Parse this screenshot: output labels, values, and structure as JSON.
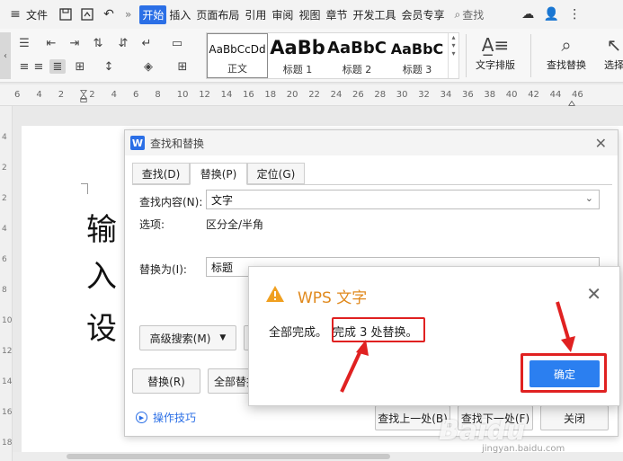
{
  "menubar": {
    "file": "文件",
    "more": "»",
    "tabs": [
      "开始",
      "插入",
      "页面布局",
      "引用",
      "审阅",
      "视图",
      "章节",
      "开发工具",
      "会员专享"
    ],
    "search": "查找"
  },
  "ribbon": {
    "styles": [
      {
        "preview": "AaBbCcDd",
        "name": "正文"
      },
      {
        "preview": "AaBb",
        "name": "标题 1"
      },
      {
        "preview": "AaBbC",
        "name": "标题 2"
      },
      {
        "preview": "AaBbC",
        "name": "标题 3"
      }
    ],
    "text_layout": "文字排版",
    "find_replace": "查找替换",
    "select": "选择"
  },
  "ruler": {
    "ticks": [
      "6",
      "4",
      "2",
      "2",
      "4",
      "6",
      "8",
      "10",
      "12",
      "14",
      "16",
      "18",
      "20",
      "22",
      "24",
      "26",
      "28",
      "30",
      "32",
      "34",
      "36",
      "38",
      "40",
      "42",
      "44",
      "46"
    ]
  },
  "vruler": {
    "ticks": [
      "4",
      "2",
      "2",
      "4",
      "6",
      "8",
      "10",
      "12",
      "14",
      "16",
      "18"
    ]
  },
  "document": {
    "lines": [
      "输",
      "入",
      "设"
    ]
  },
  "find_replace": {
    "title": "查找和替换",
    "tabs": [
      "查找(D)",
      "替换(P)",
      "定位(G)"
    ],
    "find_label": "查找内容(N):",
    "find_value": "文字",
    "options_label": "选项:",
    "options_value": "区分全/半角",
    "replace_label": "替换为(I):",
    "replace_value": "标题",
    "advanced_button": "高级搜索(M)",
    "replace_button": "替换(R)",
    "replace_all_button": "全部替换",
    "tips_link": "操作技巧",
    "find_prev_button": "查找上一处(B)",
    "find_next_button": "查找下一处(F)",
    "close_button": "关闭"
  },
  "alert": {
    "title": "WPS 文字",
    "message_prefix": "全部完成。",
    "message_highlight": "完成 3 处替换。",
    "ok_button": "确定"
  },
  "watermark": {
    "logo": "Baidu",
    "url": "jingyan.baidu.com"
  },
  "colors": {
    "accent": "#2b6fe6",
    "annotation_red": "#e02121",
    "warning_orange": "#e0891d"
  }
}
